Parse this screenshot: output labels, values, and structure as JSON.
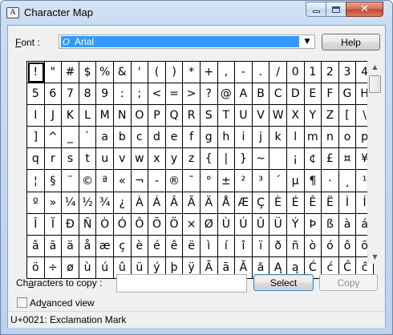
{
  "window": {
    "title": "Character Map",
    "icon": "charmap-app-icon",
    "icon_text": "A"
  },
  "font": {
    "label_underlined": "F",
    "label_rest": "ont :",
    "value": "Arial",
    "value_icon": "truetype-icon",
    "value_icon_text": "O"
  },
  "buttons": {
    "help": "Help",
    "select": "Select",
    "copy": "Copy",
    "close_glyph": "✕"
  },
  "grid": {
    "selected_index": 0,
    "chars": [
      "!",
      "\"",
      "#",
      "$",
      "%",
      "&",
      "'",
      "(",
      ")",
      "*",
      "+",
      ",",
      "-",
      ".",
      "/",
      "0",
      "1",
      "2",
      "3",
      "4",
      "5",
      "6",
      "7",
      "8",
      "9",
      ":",
      ";",
      "<",
      "=",
      ">",
      "?",
      "@",
      "A",
      "B",
      "C",
      "D",
      "E",
      "F",
      "G",
      "H",
      "I",
      "J",
      "K",
      "L",
      "M",
      "N",
      "O",
      "P",
      "Q",
      "R",
      "S",
      "T",
      "U",
      "V",
      "W",
      "X",
      "Y",
      "Z",
      "[",
      "\\",
      "]",
      "^",
      "_",
      "`",
      "a",
      "b",
      "c",
      "d",
      "e",
      "f",
      "g",
      "h",
      "i",
      "j",
      "k",
      "l",
      "m",
      "n",
      "o",
      "p",
      "q",
      "r",
      "s",
      "t",
      "u",
      "v",
      "w",
      "x",
      "y",
      "z",
      "{",
      "|",
      "}",
      "~",
      " ",
      "¡",
      "¢",
      "£",
      "¤",
      "¥",
      "¦",
      "§",
      "¨",
      "©",
      "ª",
      "«",
      "¬",
      "-",
      "®",
      "¯",
      "°",
      "±",
      "²",
      "³",
      "´",
      "µ",
      "¶",
      "·",
      "¸",
      "¹",
      "º",
      "»",
      "¼",
      "½",
      "¾",
      "¿",
      "À",
      "Á",
      "Â",
      "Ã",
      "Ä",
      "Å",
      "Æ",
      "Ç",
      "È",
      "É",
      "Ê",
      "Ë",
      "Ì",
      "Í",
      "Î",
      "Ï",
      "Ð",
      "Ñ",
      "Ò",
      "Ó",
      "Ô",
      "Õ",
      "Ö",
      "×",
      "Ø",
      "Ù",
      "Ú",
      "Û",
      "Ü",
      "Ý",
      "Þ",
      "ß",
      "à",
      "á",
      "â",
      "ã",
      "ä",
      "å",
      "æ",
      "ç",
      "è",
      "é",
      "ê",
      "ë",
      "ì",
      "í",
      "î",
      "ï",
      "ð",
      "ñ",
      "ò",
      "ó",
      "ô",
      "õ",
      "ö",
      "÷",
      "ø",
      "ù",
      "ú",
      "û",
      "ü",
      "ý",
      "þ",
      "ÿ",
      "Ā",
      "ā",
      "Ă",
      "ă",
      "Ą",
      "ą",
      "Ć",
      "ć",
      "Ĉ",
      "ĉ"
    ]
  },
  "copy": {
    "label_pre": "Ch",
    "label_underlined": "a",
    "label_post": "racters to copy :",
    "value": ""
  },
  "advanced": {
    "label_pre": "Ad",
    "label_underlined": "v",
    "label_post": "anced view",
    "checked": false
  },
  "status": {
    "text": "U+0021: Exclamation Mark"
  }
}
